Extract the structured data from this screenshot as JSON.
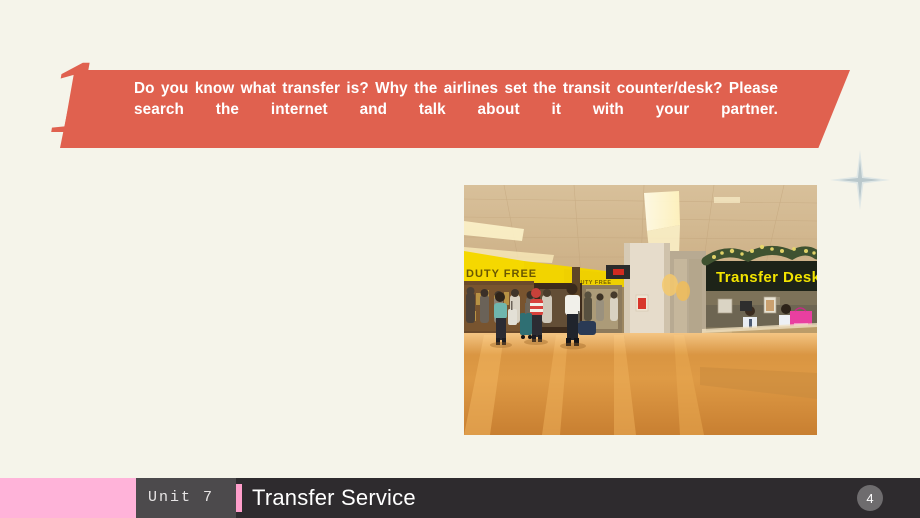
{
  "slide": {
    "background_color": "#f5f4ea",
    "number_marker": "1"
  },
  "banner": {
    "accent_color": "#e0614f",
    "text_color": "#ffffff",
    "prompt": "Do you know what transfer is? Why the airlines set the transit counter/desk? Please search the internet and talk about it with your partner.",
    "decoration_icon": "sparkle-star-icon",
    "decoration_color": "#cfd8d8"
  },
  "photo": {
    "caption_sign": "Transfer Desk",
    "secondary_signs": [
      "DUTY FREE",
      "DUTY FREE"
    ],
    "scene": "airport-terminal-transfer-desk",
    "sign_text_color": "#f2e400",
    "floor_color": "#d8913f"
  },
  "footer": {
    "pink_color": "#ffb3d9",
    "bar_color": "#2e2b2e",
    "unit_label": "Unit 7",
    "divider_color": "#ff9ecb",
    "title": "Transfer Service",
    "page_number": "4",
    "page_badge_color": "#6e6c6e"
  }
}
